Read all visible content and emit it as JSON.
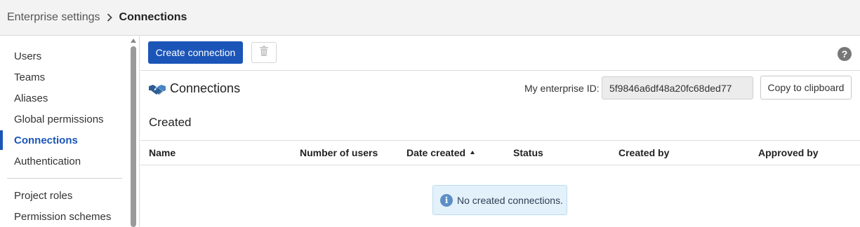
{
  "breadcrumb": {
    "parent": "Enterprise settings",
    "current": "Connections"
  },
  "sidebar": {
    "items": [
      {
        "label": "Users"
      },
      {
        "label": "Teams"
      },
      {
        "label": "Aliases"
      },
      {
        "label": "Global permissions"
      },
      {
        "label": "Connections",
        "active": true
      },
      {
        "label": "Authentication"
      },
      {
        "label": "Project roles"
      },
      {
        "label": "Permission schemes"
      }
    ]
  },
  "toolbar": {
    "create_label": "Create connection",
    "delete_icon": "trash-icon",
    "help_icon": "help-icon",
    "help_glyph": "?"
  },
  "section": {
    "title": "Connections",
    "icon": "handshake-icon",
    "enterprise_id_label": "My enterprise ID:",
    "enterprise_id_value": "5f9846a6df48a20fc68ded77",
    "copy_label": "Copy to clipboard"
  },
  "created": {
    "title": "Created",
    "columns": [
      "Name",
      "Number of users",
      "Date created",
      "Status",
      "Created by",
      "Approved by"
    ],
    "sorted_column": "Date created",
    "sort_direction": "ascending",
    "empty_message": "No created connections.",
    "info_glyph": "i"
  },
  "colors": {
    "accent": "#1b55b8",
    "info_bg": "#e3f1fb",
    "info_icon": "#5d8fc6"
  }
}
